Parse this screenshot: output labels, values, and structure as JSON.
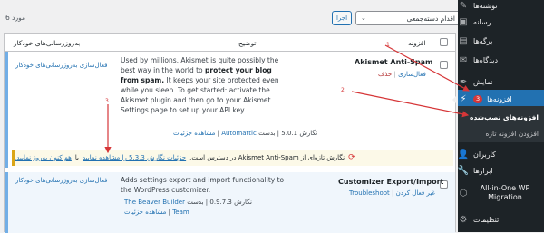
{
  "sidebar": {
    "items": [
      {
        "label": "نوشته‌ها",
        "icon": "pin-icon"
      },
      {
        "label": "رسانه",
        "icon": "media-icon"
      },
      {
        "label": "برگه‌ها",
        "icon": "page-icon"
      },
      {
        "label": "دیدگاه‌ها",
        "icon": "comment-icon"
      },
      {
        "label": "نمایش",
        "icon": "brush-icon"
      },
      {
        "label": "افزونه‌ها",
        "icon": "plugin-icon",
        "badge": "3"
      },
      {
        "label": "کاربران",
        "icon": "user-icon"
      },
      {
        "label": "ابزارها",
        "icon": "wrench-icon"
      },
      {
        "label": "All-in-One WP Migration",
        "icon": "migration-icon"
      },
      {
        "label": "تنظیمات",
        "icon": "settings-icon"
      }
    ],
    "submenu": {
      "current": "افزونه‌های نصب‌شده",
      "add_new": "افزودن افزونه تازه"
    }
  },
  "toolbar": {
    "bulk_action": "اقدام دسته‌جمعی",
    "apply": "اجرا",
    "items_count": "6 مورد"
  },
  "table": {
    "headers": {
      "plugin": "افزونه",
      "description": "توضیح",
      "auto_updates": "به‌روزرسانی‌های خودکار"
    },
    "rows": [
      {
        "name": "Akismet Anti-Spam",
        "actions": [
          "فعال‌سازی",
          "حذف"
        ],
        "description_lines": [
          "Used by millions, Akismet is quite possibly the",
          "best way in the world to ",
          "protect your blog",
          "from spam.",
          " It keeps your site protected even",
          "while you sleep. To get started: activate the",
          "Akismet plugin and then go to your Akismet",
          "Settings page to set up your API key."
        ],
        "version": "نگارش 5.0.1",
        "by": "بدست",
        "author": "Automattic",
        "view_details": "مشاهده جزئیات",
        "auto_update": "فعال‌سازی به‌روزرسانی‌های خودکار"
      },
      {
        "name": "Customizer Export/Import",
        "actions": [
          "غیر فعال کردن",
          "Troubleshoot"
        ],
        "description_lines": [
          "Adds settings export and import functionality to",
          "the WordPress customizer."
        ],
        "version": "نگارش 0.9.7.3",
        "by": "بدست",
        "author": "The Beaver Builder",
        "author2": "Team",
        "view_details": "مشاهده جزئیات",
        "auto_update": "فعال‌سازی به‌روزرسانی‌های خودکار"
      }
    ]
  },
  "notice": {
    "text": "نگارش تازه‌ای از Akismet Anti-Spam در دسترس است.",
    "details_link": "جزئیات نگارش 5.3.3 را مشاهده نمایید",
    "or": "یا",
    "update_link": "هم‌اکنون به‌روز نمایید."
  },
  "annotations": [
    "1",
    "2",
    "3"
  ],
  "colors": {
    "sidebar_bg": "#1d2327",
    "accent": "#2271b1",
    "badge": "#d63638",
    "notice_border": "#dba617",
    "arrow": "#d63638"
  }
}
